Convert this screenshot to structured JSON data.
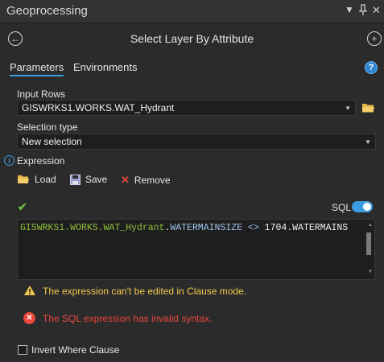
{
  "window": {
    "title": "Geoprocessing",
    "controls": {
      "dropdown_icon": "triangle-down",
      "pin_icon": "pin",
      "close_icon": "close"
    }
  },
  "header": {
    "tool_title": "Select Layer By Attribute",
    "back_icon": "back-arrow-circle",
    "add_icon": "plus-circle"
  },
  "tabs": [
    {
      "label": "Parameters",
      "active": true
    },
    {
      "label": "Environments",
      "active": false
    }
  ],
  "help_icon": "question-circle",
  "input_rows": {
    "label": "Input Rows",
    "value": "GISWRKS1.WORKS.WAT_Hydrant"
  },
  "selection_type": {
    "label": "Selection type",
    "value": "New selection"
  },
  "expression": {
    "label": "Expression",
    "info_icon": "info-circle",
    "load_label": "Load",
    "save_label": "Save",
    "remove_label": "Remove",
    "sql_label": "SQL",
    "sql_enabled": true,
    "valid_icon": "checkmark",
    "sql_parts": {
      "layer": "GISWRKS1.WORKS.WAT_Hydrant",
      "dot": ".",
      "field": "WATERMAINSIZE <> ",
      "value": "1704.WATERMAINS"
    }
  },
  "messages": {
    "warning": "The expression can't be edited in Clause mode.",
    "error": "The SQL expression has invalid syntax."
  },
  "invert": {
    "label": "Invert Where Clause",
    "checked": false
  },
  "colors": {
    "accent": "#3d9be0",
    "warning": "#f2c94c",
    "error": "#e8473b",
    "sql_layer": "#8fbf3c",
    "valid_check": "#6fb43f",
    "folder": "#e8b84a"
  }
}
